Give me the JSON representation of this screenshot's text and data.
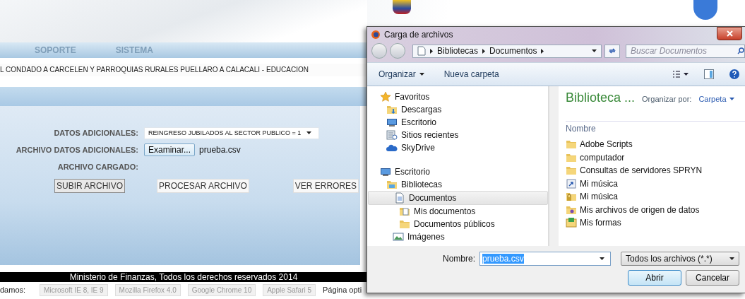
{
  "page": {
    "menu": [
      "SOPORTE",
      "SISTEMA"
    ],
    "entity": "L CONDADO A CARCELEN Y PARROQUIAS RURALES PUELLARO A CALACALI - EDUCACION",
    "fields": [
      {
        "kind": "select",
        "label": "DATOS ADICIONALES:",
        "value": "REINGRESO JUBILADOS AL SECTOR PUBLICO = 1"
      },
      {
        "kind": "file",
        "label": "ARCHIVO DATOS ADICIONALES:",
        "button": "Examinar...",
        "value": "prueba.csv"
      },
      {
        "kind": "text",
        "label": "ARCHIVO CARGADO:"
      }
    ],
    "buttons": [
      "SUBIR ARCHIVO",
      "PROCESAR ARCHIVO",
      "VER ERRORES"
    ],
    "footer": "Ministerio de Finanzas, Todos los derechos reservados 2014",
    "browsers_label": "damos:",
    "browsers": [
      "Microsoft IE 8, IE 9",
      "Mozilla Firefox 4.0",
      "Google Chrome 10",
      "Apple Safari 5"
    ],
    "optimized_text": "Página opti"
  },
  "dialog": {
    "title": "Carga de archivos",
    "breadcrumb": [
      "Bibliotecas",
      "Documentos"
    ],
    "search_placeholder": "Buscar Documentos",
    "toolbar": [
      "Organizar",
      "Nueva carpeta"
    ],
    "nav": [
      {
        "label": "Favoritos",
        "kind": "favorites",
        "selected": false,
        "children": [
          {
            "label": "Descargas",
            "kind": "downloads",
            "selected": false
          },
          {
            "label": "Escritorio",
            "kind": "desktop",
            "selected": false
          },
          {
            "label": "Sitios recientes",
            "kind": "recent",
            "selected": false
          },
          {
            "label": "SkyDrive",
            "kind": "cloud",
            "selected": false
          }
        ]
      },
      {
        "label": "Escritorio",
        "kind": "desktop",
        "selected": false,
        "children": [
          {
            "label": "Bibliotecas",
            "kind": "libraries",
            "selected": false,
            "children": [
              {
                "label": "Documentos",
                "kind": "documents",
                "selected": true,
                "children": [
                  {
                    "label": "Mis documentos",
                    "kind": "docfolder",
                    "selected": false
                  },
                  {
                    "label": "Documentos públicos",
                    "kind": "folder",
                    "selected": false
                  }
                ]
              },
              {
                "label": "Imágenes",
                "kind": "images",
                "selected": false
              }
            ]
          }
        ]
      }
    ],
    "library_title": "Biblioteca ...",
    "arrange_label": "Organizar por:",
    "arrange_value": "Carpeta",
    "column": "Nombre",
    "files": [
      {
        "name": "Adobe Scripts",
        "kind": "folder"
      },
      {
        "name": "computador",
        "kind": "folder"
      },
      {
        "name": "Consultas de servidores SPRYN",
        "kind": "folder"
      },
      {
        "name": "Mi música",
        "kind": "shortcut"
      },
      {
        "name": "Mi música",
        "kind": "locked"
      },
      {
        "name": "Mis archivos de origen de datos",
        "kind": "datasource"
      },
      {
        "name": "Mis formas",
        "kind": "form"
      }
    ],
    "filename_label": "Nombre:",
    "filename": {
      "value": "prueba.csv",
      "highlighted": true
    },
    "filter": "Todos los archivos (*.*)",
    "buttons": [
      "Abrir",
      "Cancelar"
    ]
  }
}
